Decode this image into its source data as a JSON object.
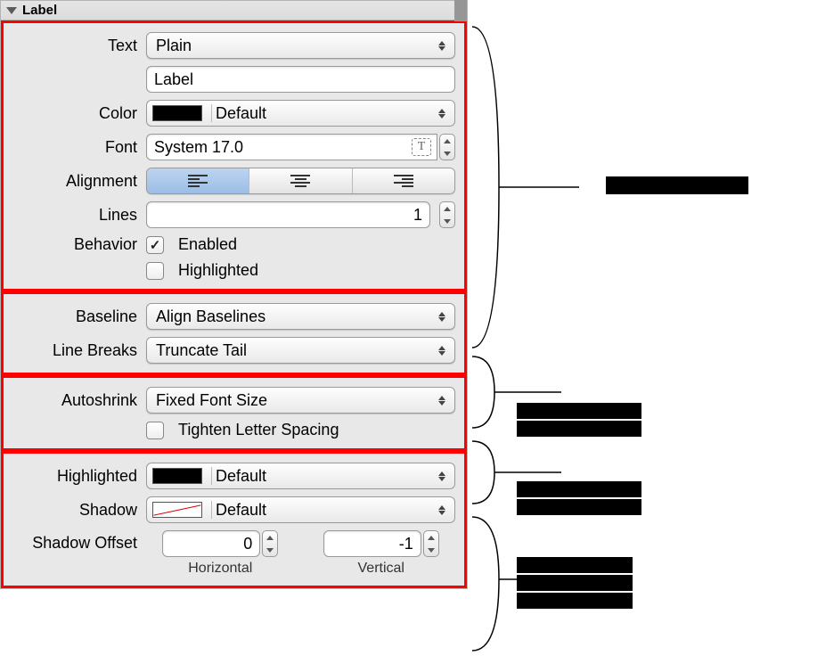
{
  "header": {
    "title": "Label"
  },
  "group1": {
    "text_label": "Text",
    "text_mode": "Plain",
    "text_value": "Label",
    "color_label": "Color",
    "color_value": "Default",
    "font_label": "Font",
    "font_value": "System 17.0",
    "alignment_label": "Alignment",
    "alignment_selected": "left",
    "lines_label": "Lines",
    "lines_value": "1",
    "behavior_label": "Behavior",
    "enabled_label": "Enabled",
    "enabled_checked": true,
    "highlighted_label": "Highlighted",
    "highlighted_checked": false
  },
  "group2": {
    "baseline_label": "Baseline",
    "baseline_value": "Align Baselines",
    "linebreaks_label": "Line Breaks",
    "linebreaks_value": "Truncate Tail"
  },
  "group3": {
    "autoshrink_label": "Autoshrink",
    "autoshrink_value": "Fixed Font Size",
    "tighten_label": "Tighten Letter Spacing",
    "tighten_checked": false
  },
  "group4": {
    "highlighted_label": "Highlighted",
    "highlighted_value": "Default",
    "shadow_label": "Shadow",
    "shadow_value": "Default",
    "shadow_offset_label": "Shadow Offset",
    "horizontal_label": "Horizontal",
    "horizontal_value": "0",
    "vertical_label": "Vertical",
    "vertical_value": "-1"
  }
}
